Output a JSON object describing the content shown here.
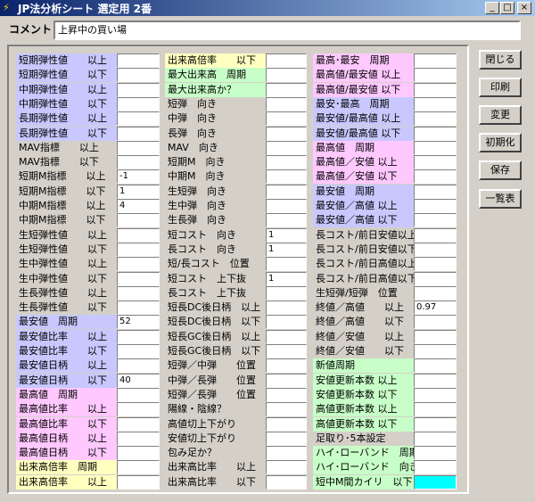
{
  "window": {
    "title": "JP法分析シート  選定用 2番",
    "min": "_",
    "max": "□",
    "close": "×"
  },
  "comment": {
    "label": "コメント",
    "value": "上昇中の買い場"
  },
  "buttons": [
    {
      "label": "閉じる"
    },
    {
      "label": "印刷"
    },
    {
      "label": "変更"
    },
    {
      "label": "初期化"
    },
    {
      "label": "保存"
    },
    {
      "label": "一覧表"
    }
  ],
  "colors": {
    "blue": "#c8c8ff",
    "pink": "#ffc8ff",
    "green": "#c8ffc8",
    "yellow": "#ffffc0",
    "cyan": "#00ffff"
  },
  "columns": [
    {
      "rows": [
        {
          "label": "短期弾性値　　以上",
          "value": "",
          "color": "blue"
        },
        {
          "label": "短期弾性値　　以下",
          "value": "",
          "color": "blue"
        },
        {
          "label": "中期弾性値　　以上",
          "value": "",
          "color": "blue"
        },
        {
          "label": "中期弾性値　　以下",
          "value": "",
          "color": "blue"
        },
        {
          "label": "長期弾性値　　以上",
          "value": "",
          "color": "blue"
        },
        {
          "label": "長期弾性値　　以下",
          "value": "",
          "color": "blue"
        },
        {
          "label": "MAV指標　　以上",
          "value": ""
        },
        {
          "label": "MAV指標　　以下",
          "value": ""
        },
        {
          "label": "短期M指標　　以上",
          "value": "-1"
        },
        {
          "label": "短期M指標　　以下",
          "value": "1"
        },
        {
          "label": "中期M指標　　以上",
          "value": "4"
        },
        {
          "label": "中期M指標　　以下",
          "value": ""
        },
        {
          "label": "生短弾性値　　以上",
          "value": ""
        },
        {
          "label": "生短弾性値　　以下",
          "value": ""
        },
        {
          "label": "生中弾性値　　以上",
          "value": ""
        },
        {
          "label": "生中弾性値　　以下",
          "value": ""
        },
        {
          "label": "生長弾性値　　以上",
          "value": ""
        },
        {
          "label": "生長弾性値　　以下",
          "value": ""
        },
        {
          "label": "最安値　周期",
          "value": "52",
          "color": "blue"
        },
        {
          "label": "最安値比率　　以上",
          "value": "",
          "color": "blue"
        },
        {
          "label": "最安値比率　　以下",
          "value": "",
          "color": "blue"
        },
        {
          "label": "最安値日柄　　以上",
          "value": "",
          "color": "blue"
        },
        {
          "label": "最安値日柄　　以下",
          "value": "40",
          "color": "blue"
        },
        {
          "label": "最高値　周期",
          "value": "",
          "color": "pink"
        },
        {
          "label": "最高値比率　　以上",
          "value": "",
          "color": "pink"
        },
        {
          "label": "最高値比率　　以下",
          "value": "",
          "color": "pink"
        },
        {
          "label": "最高値日柄　　以上",
          "value": "",
          "color": "pink"
        },
        {
          "label": "最高値日柄　　以下",
          "value": "",
          "color": "pink"
        },
        {
          "label": "出来高倍率　周期",
          "value": "",
          "color": "yellow"
        },
        {
          "label": "出来高倍率　　以上",
          "value": "",
          "color": "yellow"
        }
      ]
    },
    {
      "rows": [
        {
          "label": "出来高倍率　　以下",
          "value": "",
          "color": "yellow"
        },
        {
          "label": "最大出来高　周期",
          "value": "",
          "color": "green"
        },
        {
          "label": "最大出来高か？",
          "value": "",
          "color": "green"
        },
        {
          "label": "短弾　向き",
          "value": ""
        },
        {
          "label": "中弾　向き",
          "value": ""
        },
        {
          "label": "長弾　向き",
          "value": ""
        },
        {
          "label": "MAV　向き",
          "value": ""
        },
        {
          "label": "短期M　向き",
          "value": ""
        },
        {
          "label": "中期M　向き",
          "value": ""
        },
        {
          "label": "生短弾　向き",
          "value": ""
        },
        {
          "label": "生中弾　向き",
          "value": ""
        },
        {
          "label": "生長弾　向き",
          "value": ""
        },
        {
          "label": "短コスト　向き",
          "value": "1"
        },
        {
          "label": "長コスト　向き",
          "value": "1"
        },
        {
          "label": "短/長コスト　位置",
          "value": ""
        },
        {
          "label": "短コスト　上下抜",
          "value": "1"
        },
        {
          "label": "長コスト　上下抜",
          "value": ""
        },
        {
          "label": "短長DC後日柄　以上",
          "value": ""
        },
        {
          "label": "短長DC後日柄　以下",
          "value": ""
        },
        {
          "label": "短長GC後日柄　以上",
          "value": ""
        },
        {
          "label": "短長GC後日柄　以下",
          "value": ""
        },
        {
          "label": "短弾／中弾　　位置",
          "value": ""
        },
        {
          "label": "中弾／長弾　　位置",
          "value": ""
        },
        {
          "label": "短弾／長弾　　位置",
          "value": ""
        },
        {
          "label": "陽線・陰線？",
          "value": ""
        },
        {
          "label": "高値切上下がり",
          "value": ""
        },
        {
          "label": "安値切上下がり",
          "value": ""
        },
        {
          "label": "包み足か？",
          "value": ""
        },
        {
          "label": "出来高比率　　以上",
          "value": ""
        },
        {
          "label": "出来高比率　　以下",
          "value": ""
        }
      ]
    },
    {
      "rows": [
        {
          "label": "最高･最安　周期",
          "value": "",
          "color": "pink"
        },
        {
          "label": "最高値/最安値 以上",
          "value": "",
          "color": "pink"
        },
        {
          "label": "最高値/最安値 以下",
          "value": "",
          "color": "pink"
        },
        {
          "label": "最安･最高　周期",
          "value": "",
          "color": "blue"
        },
        {
          "label": "最安値/最高値 以上",
          "value": "",
          "color": "blue"
        },
        {
          "label": "最安値/最高値 以下",
          "value": "",
          "color": "blue"
        },
        {
          "label": "最高値　周期",
          "value": "",
          "color": "pink"
        },
        {
          "label": "最高値／安値 以上",
          "value": "",
          "color": "pink"
        },
        {
          "label": "最高値／安値 以下",
          "value": "",
          "color": "pink"
        },
        {
          "label": "最安値　周期",
          "value": "",
          "color": "blue"
        },
        {
          "label": "最安値／高値 以上",
          "value": "",
          "color": "blue"
        },
        {
          "label": "最安値／高値 以下",
          "value": "",
          "color": "blue"
        },
        {
          "label": "長コスト/前日安値以上",
          "value": ""
        },
        {
          "label": "長コスト/前日安値以下",
          "value": ""
        },
        {
          "label": "長コスト/前日高値以上",
          "value": ""
        },
        {
          "label": "長コスト/前日高値以下",
          "value": ""
        },
        {
          "label": "生短弾/短弾　位置",
          "value": ""
        },
        {
          "label": "終値／高値　　以上",
          "value": "0.97"
        },
        {
          "label": "終値／高値　　以下",
          "value": ""
        },
        {
          "label": "終値／安値　　以上",
          "value": ""
        },
        {
          "label": "終値／安値　　以下",
          "value": ""
        },
        {
          "label": "新値周期",
          "value": "",
          "color": "green"
        },
        {
          "label": "安値更新本数 以上",
          "value": "",
          "color": "green"
        },
        {
          "label": "安値更新本数 以下",
          "value": "",
          "color": "green"
        },
        {
          "label": "高値更新本数 以上",
          "value": "",
          "color": "green"
        },
        {
          "label": "高値更新本数 以下",
          "value": "",
          "color": "green"
        },
        {
          "label": "足取り･5本設定",
          "value": ""
        },
        {
          "label": "ハイ･ローバンド　周期",
          "value": "",
          "color": "green"
        },
        {
          "label": "ハイ･ローバンド　向き",
          "value": "",
          "color": "green"
        },
        {
          "label": "短中M間カイリ　以下",
          "value": "",
          "color": "green",
          "cellColor": "cyan"
        }
      ]
    }
  ]
}
